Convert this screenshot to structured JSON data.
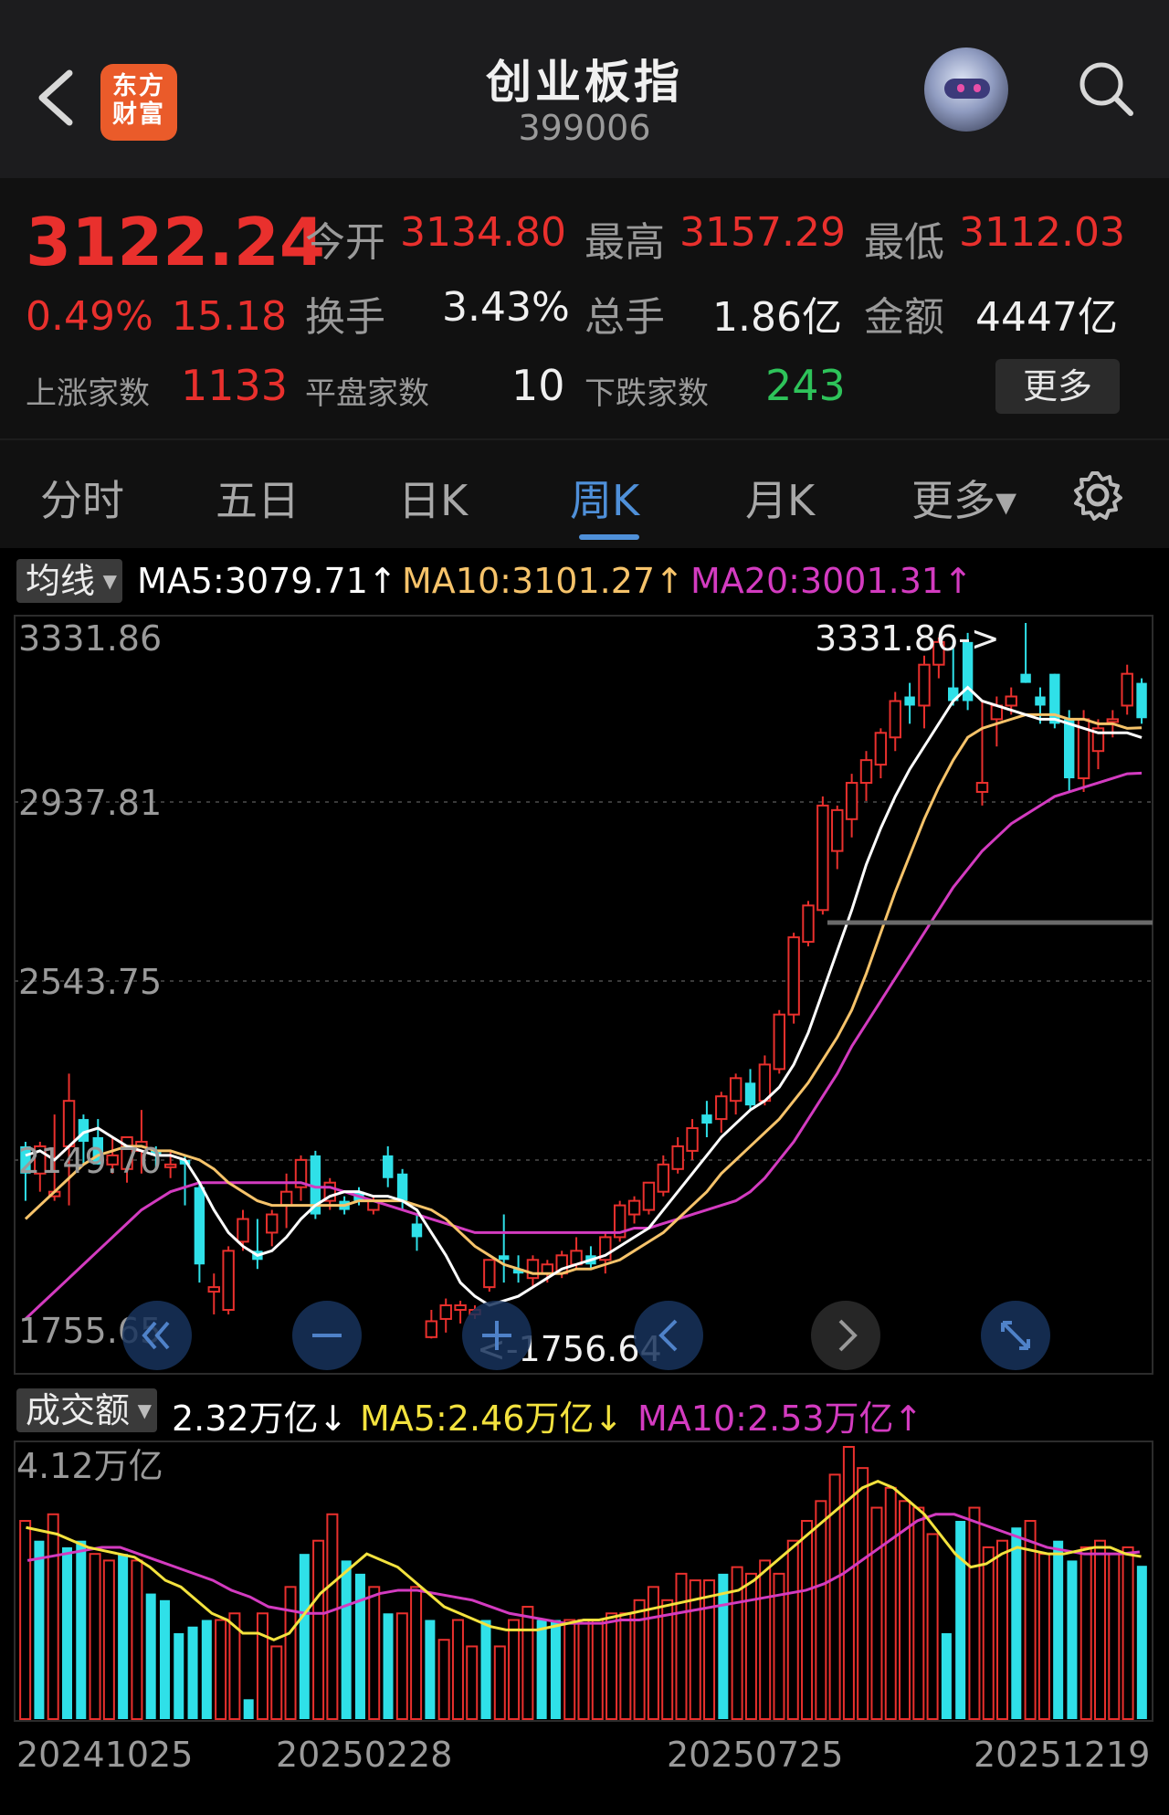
{
  "header": {
    "logo_line1": "东方",
    "logo_line2": "财富",
    "title": "创业板指",
    "code": "399006"
  },
  "quote": {
    "price": "3122.24",
    "change_pct": "0.49%",
    "change": "15.18",
    "open_label": "今开",
    "open": "3134.80",
    "high_label": "最高",
    "high": "3157.29",
    "low_label": "最低",
    "low": "3112.03",
    "turnover_label": "换手",
    "turnover": "3.43%",
    "volume_label": "总手",
    "volume": "1.86亿",
    "amount_label": "金额",
    "amount": "4447亿",
    "up_label": "上涨家数",
    "up": "1133",
    "flat_label": "平盘家数",
    "flat": "10",
    "down_label": "下跌家数",
    "down": "243",
    "more_button": "更多"
  },
  "tabs": {
    "items": [
      "分时",
      "五日",
      "日K",
      "周K",
      "月K",
      "更多▾"
    ],
    "active": "周K"
  },
  "ma_bar": {
    "selector": "均线",
    "ma5": "MA5:3079.71↑",
    "ma10": "MA10:3101.27↑",
    "ma20": "MA20:3001.31↑"
  },
  "volume_bar": {
    "selector": "成交额",
    "current": "2.32万亿↓",
    "ma5": "MA5:2.46万亿↓",
    "ma10": "MA10:2.53万亿↑"
  },
  "colors": {
    "up": "#e9302d",
    "down": "#2fe0e8",
    "ma5": "#ffffff",
    "ma10": "#f6c36a",
    "ma20": "#d33bc0",
    "accent": "#4f90d9",
    "vol_ma5": "#f3e23e",
    "vol_ma10": "#d33bc0"
  },
  "icons": {
    "back": "back-arrow-icon",
    "search": "search-icon",
    "settings": "gear-icon",
    "rewind": "double-chevron-left-icon",
    "zoom_out": "minus-icon",
    "zoom_in": "plus-icon",
    "prev": "chevron-left-icon",
    "next": "chevron-right-icon",
    "fullscreen": "expand-icon"
  },
  "chart_data": [
    {
      "type": "candlestick",
      "title": "",
      "y_ticks": [
        "3331.86",
        "2937.81",
        "2543.75",
        "2149.70",
        "1755.65"
      ],
      "ylim": [
        1755.65,
        3331.86
      ],
      "x_labels": [
        "20241025",
        "20250228",
        "20250725",
        "20251219"
      ],
      "annotations": {
        "max_label": "3331.86->",
        "min_label": "<-1756.64"
      },
      "candles": [
        [
          2180,
          2190,
          2060,
          2120
        ],
        [
          2120,
          2190,
          2080,
          2180
        ],
        [
          2070,
          2250,
          2060,
          2080
        ],
        [
          2180,
          2340,
          2050,
          2280
        ],
        [
          2240,
          2250,
          2140,
          2190
        ],
        [
          2200,
          2240,
          2140,
          2140
        ],
        [
          2140,
          2200,
          2120,
          2160
        ],
        [
          2130,
          2200,
          2100,
          2200
        ],
        [
          2170,
          2260,
          2120,
          2190
        ],
        [
          2170,
          2180,
          2130,
          2160
        ],
        [
          2140,
          2170,
          2110,
          2140
        ],
        [
          2150,
          2160,
          2050,
          2140
        ],
        [
          2090,
          2100,
          1880,
          1920
        ],
        [
          1860,
          1900,
          1810,
          1870
        ],
        [
          1820,
          1960,
          1810,
          1950
        ],
        [
          1970,
          2040,
          1950,
          2020
        ],
        [
          1950,
          2020,
          1910,
          1930
        ],
        [
          1990,
          2040,
          1960,
          2030
        ],
        [
          2050,
          2120,
          2000,
          2080
        ],
        [
          2090,
          2160,
          2060,
          2150
        ],
        [
          2160,
          2170,
          2020,
          2030
        ],
        [
          2060,
          2110,
          2040,
          2100
        ],
        [
          2060,
          2070,
          2030,
          2040
        ],
        [
          2080,
          2090,
          2050,
          2060
        ],
        [
          2040,
          2070,
          2030,
          2060
        ],
        [
          2160,
          2180,
          2090,
          2110
        ],
        [
          2120,
          2130,
          2040,
          2060
        ],
        [
          2010,
          2030,
          1950,
          1980
        ],
        [
          1760,
          1820,
          1757,
          1795
        ],
        [
          1800,
          1845,
          1770,
          1830
        ],
        [
          1820,
          1840,
          1790,
          1830
        ],
        [
          1810,
          1830,
          1800,
          1820
        ],
        [
          1870,
          1930,
          1860,
          1930
        ],
        [
          1940,
          2030,
          1880,
          1930
        ],
        [
          1910,
          1940,
          1880,
          1900
        ],
        [
          1890,
          1940,
          1870,
          1930
        ],
        [
          1900,
          1930,
          1880,
          1920
        ],
        [
          1900,
          1950,
          1890,
          1940
        ],
        [
          1920,
          1980,
          1910,
          1950
        ],
        [
          1940,
          1960,
          1910,
          1920
        ],
        [
          1930,
          1990,
          1900,
          1980
        ],
        [
          1980,
          2060,
          1970,
          2050
        ],
        [
          2030,
          2070,
          2010,
          2060
        ],
        [
          2040,
          2100,
          2030,
          2100
        ],
        [
          2080,
          2160,
          2070,
          2140
        ],
        [
          2130,
          2200,
          2120,
          2180
        ],
        [
          2170,
          2240,
          2150,
          2220
        ],
        [
          2250,
          2280,
          2200,
          2230
        ],
        [
          2240,
          2300,
          2210,
          2290
        ],
        [
          2280,
          2340,
          2250,
          2330
        ],
        [
          2320,
          2350,
          2260,
          2270
        ],
        [
          2280,
          2380,
          2270,
          2360
        ],
        [
          2350,
          2480,
          2340,
          2470
        ],
        [
          2470,
          2650,
          2450,
          2640
        ],
        [
          2630,
          2720,
          2620,
          2710
        ],
        [
          2700,
          2950,
          2690,
          2930
        ],
        [
          2830,
          2930,
          2790,
          2920
        ],
        [
          2900,
          3000,
          2860,
          2980
        ],
        [
          2980,
          3050,
          2940,
          3030
        ],
        [
          3020,
          3100,
          2990,
          3090
        ],
        [
          3080,
          3180,
          3050,
          3160
        ],
        [
          3170,
          3200,
          3110,
          3150
        ],
        [
          3150,
          3260,
          3100,
          3240
        ],
        [
          3240,
          3300,
          3210,
          3290
        ],
        [
          3190,
          3290,
          3150,
          3160
        ],
        [
          3290,
          3310,
          3140,
          3160
        ],
        [
          2960,
          3160,
          2930,
          2980
        ],
        [
          3120,
          3170,
          3060,
          3150
        ],
        [
          3150,
          3190,
          3130,
          3170
        ],
        [
          3220,
          3331.86,
          3200,
          3200
        ],
        [
          3170,
          3190,
          3110,
          3150
        ],
        [
          3220,
          3220,
          3100,
          3110
        ],
        [
          3120,
          3140,
          2960,
          2990
        ],
        [
          2990,
          3140,
          2960,
          3120
        ],
        [
          3050,
          3120,
          3010,
          3100
        ],
        [
          3120,
          3140,
          3080,
          3120
        ],
        [
          3150,
          3240,
          3130,
          3220
        ],
        [
          3200,
          3210,
          3110,
          3122.24
        ]
      ],
      "ma5": [
        2160,
        2170,
        2150,
        2180,
        2210,
        2220,
        2200,
        2180,
        2170,
        2160,
        2160,
        2150,
        2100,
        2040,
        1990,
        1960,
        1940,
        1950,
        1980,
        2020,
        2050,
        2070,
        2080,
        2080,
        2070,
        2070,
        2060,
        2040,
        1990,
        1940,
        1880,
        1850,
        1830,
        1840,
        1850,
        1870,
        1890,
        1910,
        1920,
        1930,
        1940,
        1960,
        1980,
        2000,
        2040,
        2080,
        2120,
        2160,
        2200,
        2230,
        2260,
        2280,
        2310,
        2360,
        2430,
        2520,
        2610,
        2700,
        2800,
        2880,
        2950,
        3010,
        3060,
        3110,
        3160,
        3190,
        3160,
        3150,
        3140,
        3130,
        3120,
        3120,
        3110,
        3100,
        3090,
        3090,
        3090,
        3079.71
      ],
      "ma10": [
        2020,
        2050,
        2080,
        2110,
        2140,
        2160,
        2170,
        2180,
        2180,
        2170,
        2170,
        2160,
        2150,
        2130,
        2100,
        2080,
        2060,
        2050,
        2050,
        2050,
        2050,
        2050,
        2050,
        2060,
        2060,
        2060,
        2060,
        2050,
        2040,
        2020,
        1990,
        1960,
        1940,
        1920,
        1910,
        1900,
        1900,
        1900,
        1910,
        1910,
        1920,
        1930,
        1950,
        1970,
        1990,
        2020,
        2050,
        2080,
        2120,
        2150,
        2180,
        2210,
        2240,
        2280,
        2320,
        2370,
        2420,
        2480,
        2560,
        2650,
        2740,
        2820,
        2900,
        2970,
        3030,
        3080,
        3100,
        3110,
        3120,
        3130,
        3130,
        3130,
        3120,
        3120,
        3110,
        3110,
        3100,
        3101.27
      ],
      "ma20": [
        1800,
        1830,
        1860,
        1890,
        1920,
        1950,
        1980,
        2010,
        2040,
        2060,
        2080,
        2090,
        2100,
        2100,
        2100,
        2100,
        2100,
        2100,
        2100,
        2100,
        2090,
        2090,
        2080,
        2070,
        2060,
        2050,
        2040,
        2030,
        2020,
        2010,
        2000,
        1990,
        1990,
        1990,
        1990,
        1990,
        1990,
        1990,
        1990,
        1990,
        1990,
        1990,
        2000,
        2000,
        2010,
        2020,
        2030,
        2040,
        2050,
        2060,
        2080,
        2110,
        2150,
        2190,
        2240,
        2290,
        2340,
        2400,
        2450,
        2500,
        2550,
        2600,
        2650,
        2700,
        2750,
        2790,
        2830,
        2860,
        2890,
        2910,
        2930,
        2950,
        2960,
        2970,
        2980,
        2990,
        3000,
        3001.31
      ]
    },
    {
      "type": "bar",
      "title": "",
      "y_label": "4.12万亿",
      "unit": "万亿",
      "ylim": [
        0,
        4.12
      ],
      "values": [
        3.0,
        2.7,
        3.1,
        2.6,
        2.7,
        2.5,
        2.4,
        2.5,
        2.4,
        1.9,
        1.8,
        1.3,
        1.4,
        1.5,
        1.5,
        1.6,
        0.3,
        1.6,
        1.1,
        2.0,
        2.5,
        2.7,
        3.1,
        2.4,
        2.2,
        2.0,
        1.6,
        1.6,
        2.0,
        1.5,
        1.2,
        1.5,
        1.1,
        1.5,
        1.1,
        1.5,
        1.7,
        1.5,
        1.5,
        1.5,
        1.5,
        1.5,
        1.6,
        1.6,
        1.8,
        2.0,
        1.8,
        2.2,
        2.1,
        2.1,
        2.2,
        2.3,
        2.2,
        2.4,
        2.2,
        2.7,
        3.0,
        3.3,
        3.7,
        4.12,
        3.8,
        3.2,
        3.5,
        3.3,
        3.2,
        2.8,
        1.3,
        3.0,
        3.2,
        2.6,
        2.7,
        2.9,
        3.0,
        2.5,
        2.7,
        2.4,
        2.6,
        2.7,
        2.5,
        2.6,
        2.32
      ],
      "colors": [
        "up",
        "down",
        "up",
        "down",
        "down",
        "up",
        "up",
        "down",
        "up",
        "down",
        "down",
        "down",
        "down",
        "down",
        "up",
        "up",
        "down",
        "up",
        "up",
        "up",
        "down",
        "up",
        "up",
        "down",
        "down",
        "up",
        "down",
        "up",
        "up",
        "down",
        "up",
        "up",
        "up",
        "down",
        "up",
        "up",
        "up",
        "down",
        "down",
        "up",
        "up",
        "up",
        "up",
        "up",
        "up",
        "up",
        "up",
        "up",
        "up",
        "up",
        "down",
        "up",
        "up",
        "up",
        "up",
        "up",
        "up",
        "up",
        "up",
        "up",
        "up",
        "up",
        "up",
        "up",
        "up",
        "up",
        "down",
        "down",
        "up",
        "up",
        "up",
        "down",
        "up",
        "up",
        "down",
        "down",
        "up",
        "up",
        "up",
        "up",
        "down"
      ],
      "ma5": [
        2.9,
        2.85,
        2.8,
        2.7,
        2.6,
        2.55,
        2.5,
        2.45,
        2.3,
        2.1,
        2.0,
        1.8,
        1.6,
        1.5,
        1.3,
        1.3,
        1.2,
        1.3,
        1.6,
        1.9,
        2.1,
        2.3,
        2.5,
        2.4,
        2.3,
        2.1,
        1.9,
        1.7,
        1.6,
        1.5,
        1.4,
        1.35,
        1.35,
        1.35,
        1.4,
        1.45,
        1.5,
        1.5,
        1.55,
        1.6,
        1.65,
        1.7,
        1.75,
        1.8,
        1.85,
        1.9,
        1.95,
        2.1,
        2.3,
        2.5,
        2.7,
        2.9,
        3.1,
        3.3,
        3.5,
        3.6,
        3.5,
        3.3,
        3.1,
        2.8,
        2.5,
        2.3,
        2.35,
        2.5,
        2.6,
        2.55,
        2.5,
        2.5,
        2.55,
        2.6,
        2.6,
        2.5,
        2.46
      ],
      "ma10": [
        2.4,
        2.45,
        2.5,
        2.55,
        2.6,
        2.6,
        2.5,
        2.4,
        2.3,
        2.2,
        2.1,
        1.95,
        1.85,
        1.7,
        1.65,
        1.6,
        1.6,
        1.7,
        1.8,
        1.9,
        1.95,
        1.95,
        1.9,
        1.85,
        1.8,
        1.7,
        1.6,
        1.55,
        1.5,
        1.45,
        1.45,
        1.45,
        1.5,
        1.5,
        1.55,
        1.6,
        1.65,
        1.7,
        1.75,
        1.8,
        1.85,
        1.9,
        1.95,
        2.05,
        2.2,
        2.4,
        2.6,
        2.8,
        3.0,
        3.1,
        3.1,
        3.0,
        2.9,
        2.8,
        2.7,
        2.6,
        2.55,
        2.5,
        2.5,
        2.5,
        2.53
      ]
    }
  ]
}
